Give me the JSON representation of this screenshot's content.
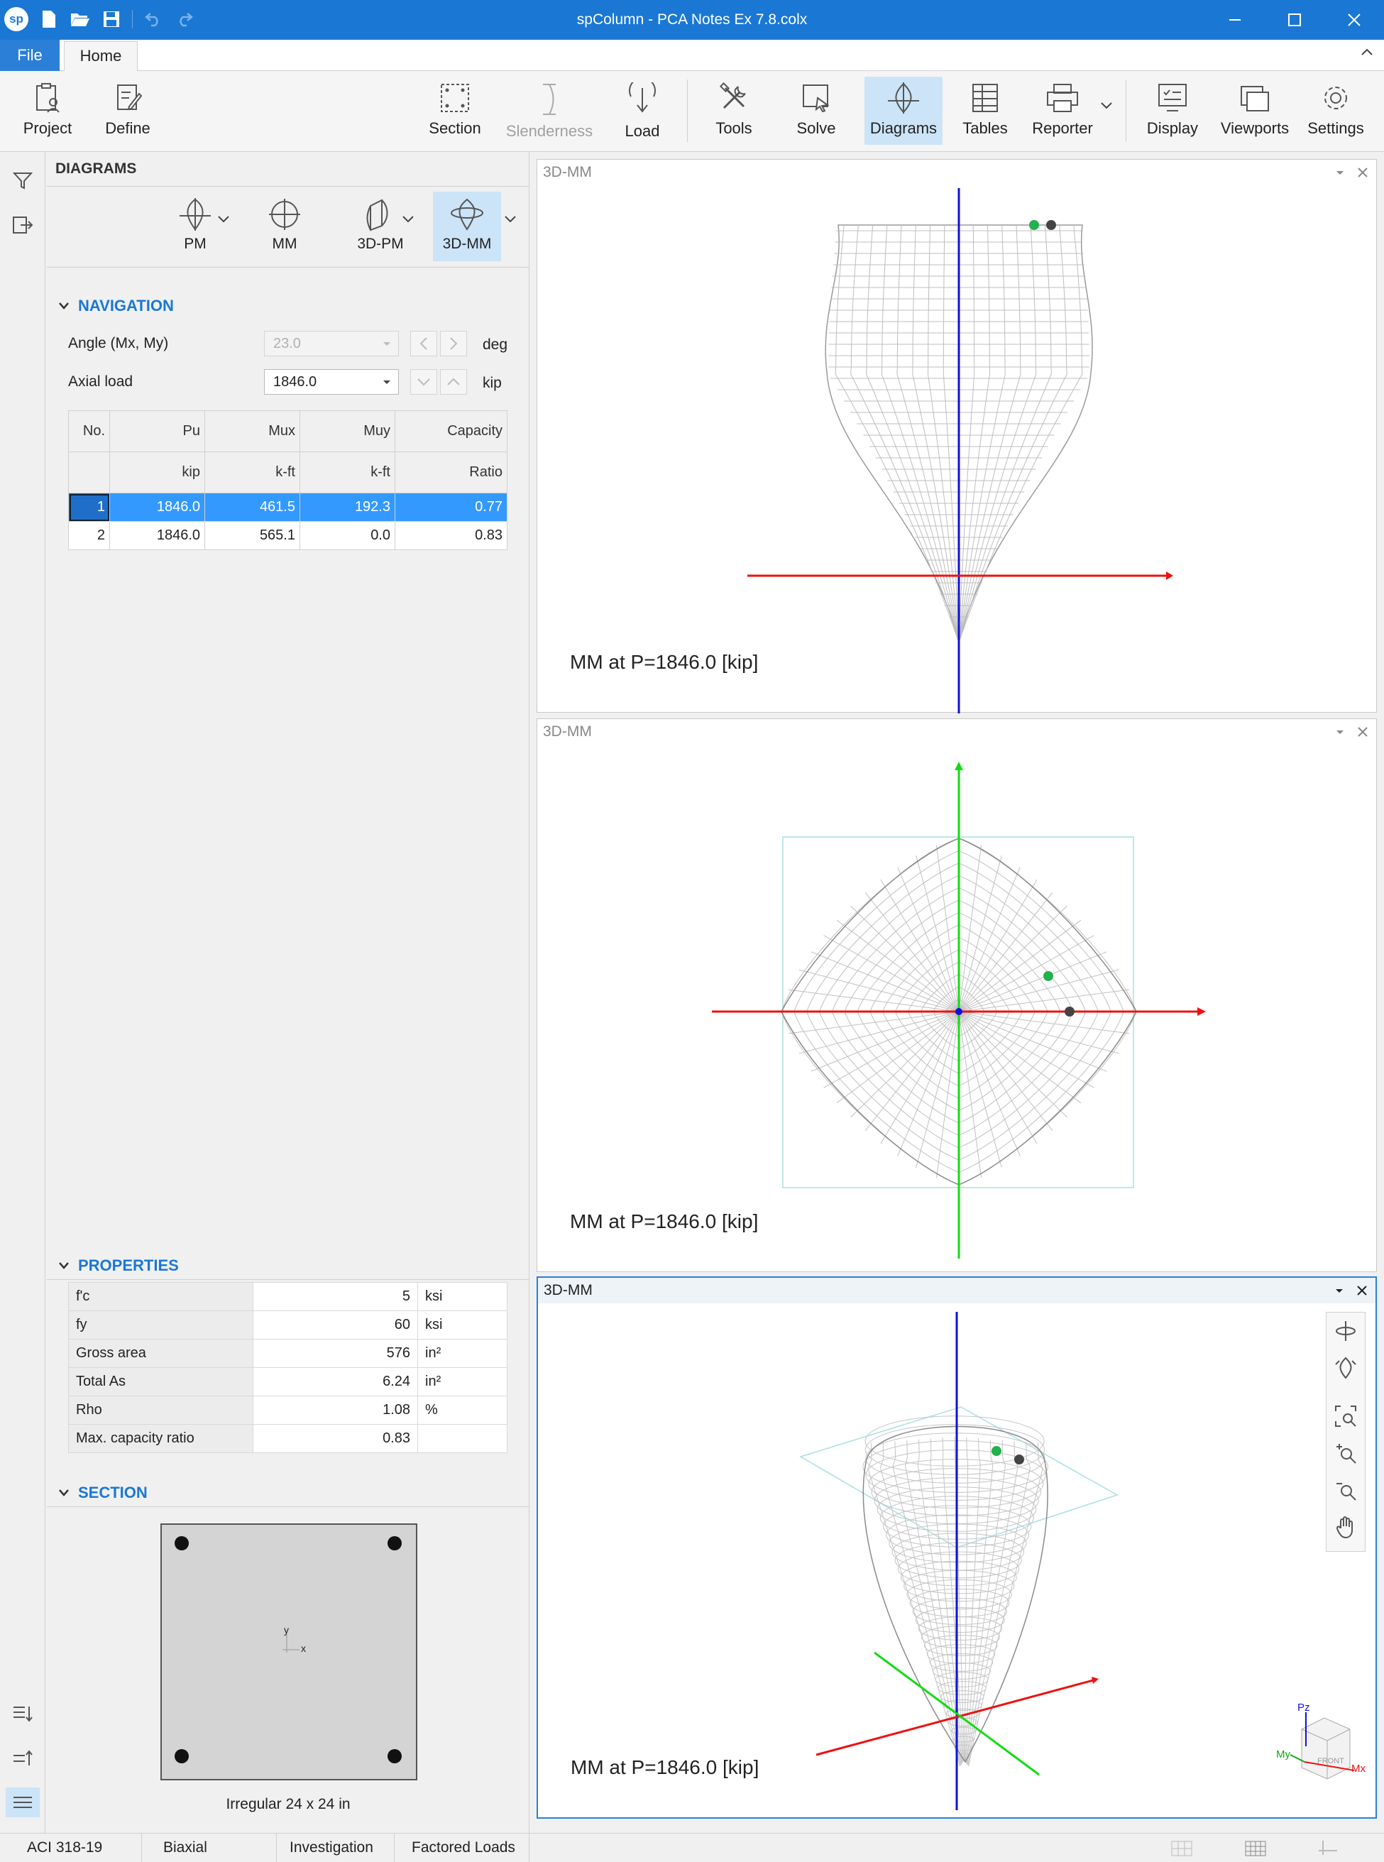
{
  "window": {
    "title": "spColumn - PCA Notes Ex 7.8.colx",
    "logo": "sp"
  },
  "tabs": {
    "file": "File",
    "home": "Home"
  },
  "ribbon": {
    "project": "Project",
    "define": "Define",
    "section": "Section",
    "slenderness": "Slenderness",
    "load": "Load",
    "tools": "Tools",
    "solve": "Solve",
    "diagrams": "Diagrams",
    "tables": "Tables",
    "reporter": "Reporter",
    "display": "Display",
    "viewports": "Viewports",
    "settings": "Settings"
  },
  "panel": {
    "header": "DIAGRAMS",
    "diagram_buttons": {
      "pm": "PM",
      "mm": "MM",
      "pm3d": "3D-PM",
      "mm3d": "3D-MM"
    },
    "navigation": {
      "title": "NAVIGATION",
      "angle_label": "Angle (Mx, My)",
      "angle_value": "23.0",
      "angle_unit": "deg",
      "axial_label": "Axial load",
      "axial_value": "1846.0",
      "axial_unit": "kip"
    },
    "table": {
      "headers": [
        "No.",
        "Pu",
        "Mux",
        "Muy",
        "Capacity"
      ],
      "units": [
        "",
        "kip",
        "k-ft",
        "k-ft",
        "Ratio"
      ],
      "rows": [
        [
          "1",
          "1846.0",
          "461.5",
          "192.3",
          "0.77"
        ],
        [
          "2",
          "1846.0",
          "565.1",
          "0.0",
          "0.83"
        ]
      ]
    },
    "properties": {
      "title": "PROPERTIES",
      "rows": [
        {
          "name": "f'c",
          "value": "5",
          "unit": "ksi"
        },
        {
          "name": "fy",
          "value": "60",
          "unit": "ksi"
        },
        {
          "name": "Gross area",
          "value": "576",
          "unit": "in²"
        },
        {
          "name": "Total As",
          "value": "6.24",
          "unit": "in²"
        },
        {
          "name": "Rho",
          "value": "1.08",
          "unit": "%"
        },
        {
          "name": "Max. capacity ratio",
          "value": "0.83",
          "unit": ""
        }
      ]
    },
    "section": {
      "title": "SECTION",
      "caption": "Irregular 24 x 24 in",
      "axis_y": "y",
      "axis_x": "x"
    }
  },
  "viewports": [
    {
      "title": "3D-MM",
      "caption": "MM at P=1846.0 [kip]"
    },
    {
      "title": "3D-MM",
      "caption": "MM at P=1846.0 [kip]"
    },
    {
      "title": "3D-MM",
      "caption": "MM at P=1846.0 [kip]"
    }
  ],
  "gizmo": {
    "pz": "Pz",
    "my": "My",
    "mx": "Mx",
    "front": "FRONT"
  },
  "statusbar": {
    "code": "ACI 318-19",
    "mode": "Biaxial",
    "run": "Investigation",
    "loads": "Factored Loads"
  },
  "colors": {
    "accent": "#1a78d4",
    "selected": "#3399ff",
    "axis_x": "#ff0000",
    "axis_y": "#00cc00",
    "axis_z": "#0000dd",
    "point_green": "#22b14c",
    "point_dark": "#444444"
  }
}
